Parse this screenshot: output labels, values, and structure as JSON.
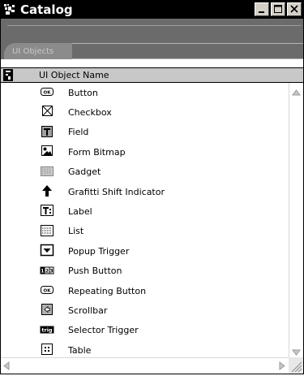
{
  "window": {
    "title": "Catalog"
  },
  "tabs": [
    {
      "label": "UI Objects"
    }
  ],
  "column_header": {
    "label": "UI Object Name"
  },
  "items": [
    {
      "label": "Button",
      "icon": "button-icon"
    },
    {
      "label": "Checkbox",
      "icon": "checkbox-icon"
    },
    {
      "label": "Field",
      "icon": "field-icon"
    },
    {
      "label": "Form Bitmap",
      "icon": "form-bitmap-icon"
    },
    {
      "label": "Gadget",
      "icon": "gadget-icon"
    },
    {
      "label": "Grafitti Shift Indicator",
      "icon": "shift-indicator-icon"
    },
    {
      "label": "Label",
      "icon": "label-icon"
    },
    {
      "label": "List",
      "icon": "list-icon"
    },
    {
      "label": "Popup Trigger",
      "icon": "popup-trigger-icon"
    },
    {
      "label": "Push Button",
      "icon": "push-button-icon"
    },
    {
      "label": "Repeating Button",
      "icon": "repeating-button-icon"
    },
    {
      "label": "Scrollbar",
      "icon": "scrollbar-icon"
    },
    {
      "label": "Selector Trigger",
      "icon": "selector-trigger-icon"
    },
    {
      "label": "Table",
      "icon": "table-icon"
    }
  ],
  "colors": {
    "title_bar": "#000000",
    "tab_strip": "#6b6b6b",
    "header": "#c8c8c8"
  }
}
